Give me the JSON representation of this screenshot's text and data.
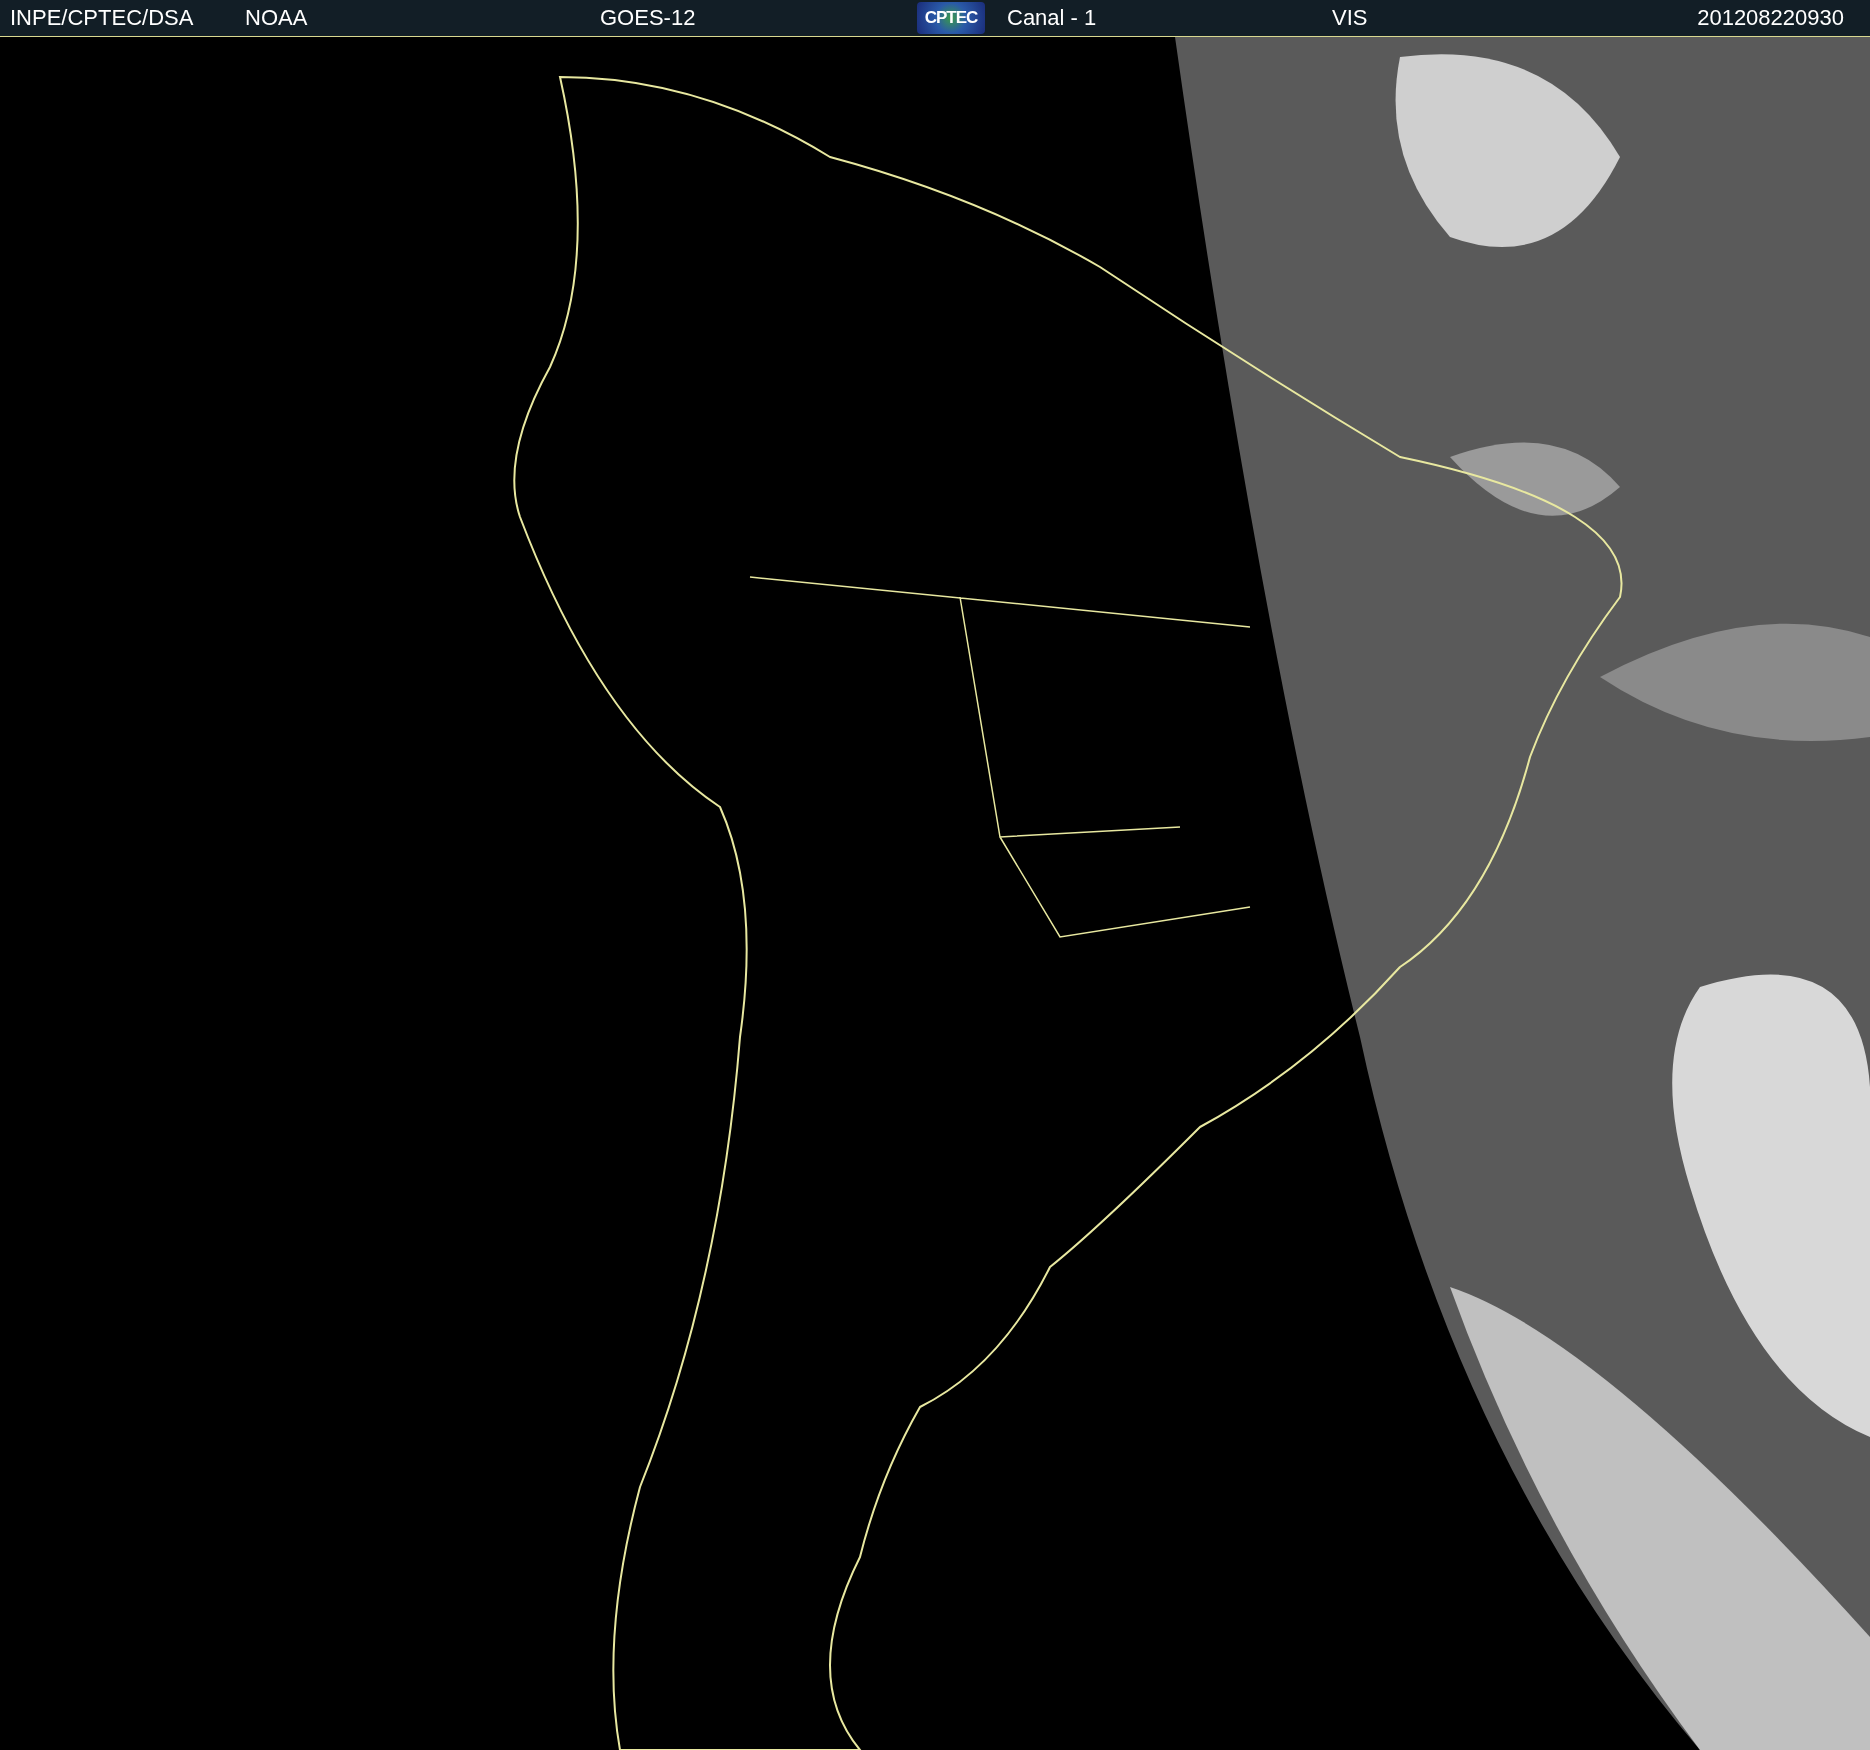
{
  "header": {
    "items": [
      {
        "kind": "text",
        "text": "INPE/CPTEC/DSA"
      },
      {
        "kind": "text",
        "text": "NOAA"
      },
      {
        "kind": "text",
        "text": "GOES-12"
      },
      {
        "kind": "logo",
        "text": "CPTEC"
      },
      {
        "kind": "text",
        "text": "Canal - 1"
      },
      {
        "kind": "text",
        "text": "VIS"
      },
      {
        "kind": "text",
        "text": "201208220930"
      }
    ]
  }
}
